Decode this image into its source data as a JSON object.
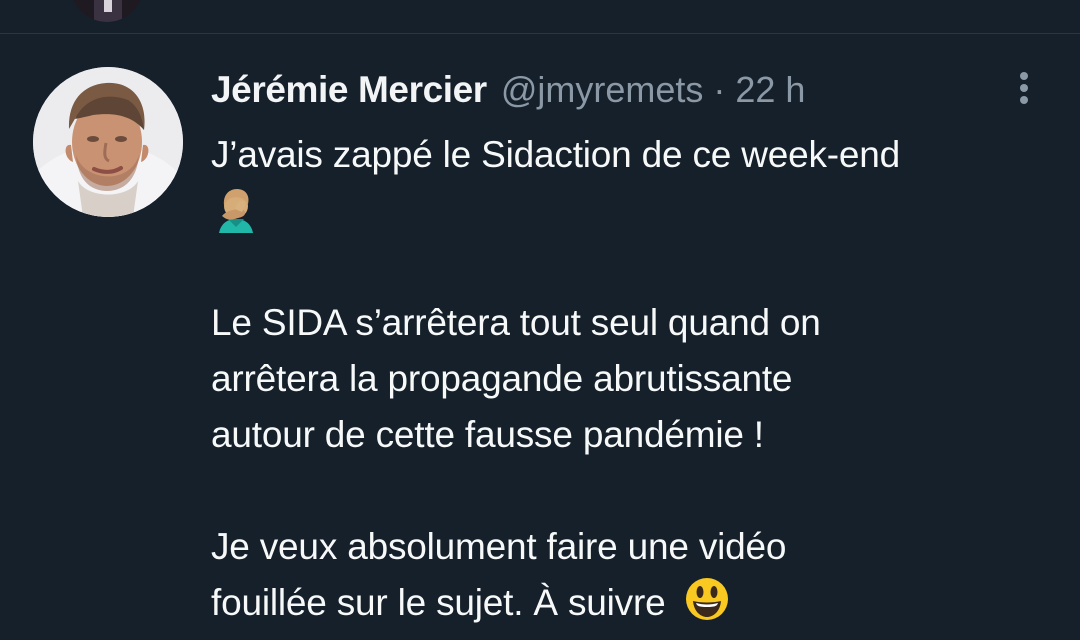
{
  "tweet": {
    "author": {
      "display_name": "Jérémie Mercier",
      "handle": "@jmyremets"
    },
    "separator": "·",
    "time": "22 h",
    "body": {
      "line1": "J’avais zappé le Sidaction de ce week-end",
      "line1_emoji": "facepalm-emoji",
      "paragraph2_line1": "Le SIDA s’arrêtera tout seul quand on",
      "paragraph2_line2": "arrêtera la propagande abrutissante",
      "paragraph2_line3": "autour de cette fausse pandémie !",
      "paragraph3_line1": "Je veux absolument faire une vidéo",
      "paragraph3_line2": "fouillée sur le sujet. À suivre",
      "paragraph3_emoji": "grinning-face-emoji"
    }
  },
  "colors": {
    "background": "#15202b",
    "divider": "#2c3640",
    "text_primary": "#f7f9f9",
    "text_secondary": "#8b98a5"
  },
  "icons": {
    "more": "more-vertical-icon"
  }
}
